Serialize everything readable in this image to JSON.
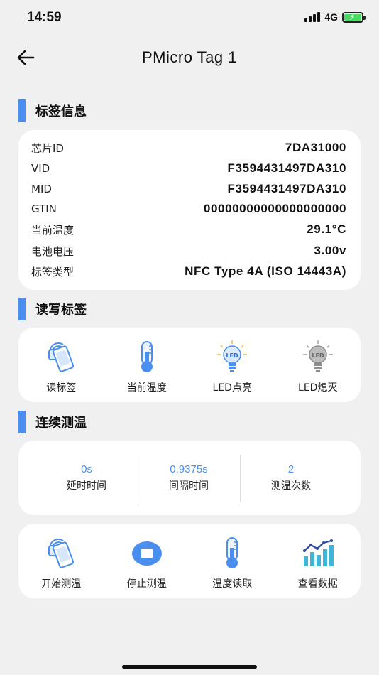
{
  "status": {
    "time": "14:59",
    "network": "4G"
  },
  "nav": {
    "title": "PMicro Tag 1"
  },
  "sections": {
    "tag_info": "标签信息",
    "read_write": "读写标签",
    "continuous": "连续测温"
  },
  "tag_info": [
    {
      "label": "芯片ID",
      "value": "7DA31000"
    },
    {
      "label": "VID",
      "value": "F3594431497DA310"
    },
    {
      "label": "MID",
      "value": "F3594431497DA310"
    },
    {
      "label": "GTIN",
      "value": "00000000000000000000"
    },
    {
      "label": "当前温度",
      "value": "29.1°C"
    },
    {
      "label": "电池电压",
      "value": "3.00v"
    },
    {
      "label": "标签类型",
      "value": "NFC Type 4A (ISO 14443A)"
    }
  ],
  "rw_buttons": [
    {
      "label": "读标签",
      "icon": "nfc-phone-icon"
    },
    {
      "label": "当前温度",
      "icon": "thermometer-icon"
    },
    {
      "label": "LED点亮",
      "icon": "led-on-icon"
    },
    {
      "label": "LED熄灭",
      "icon": "led-off-icon"
    }
  ],
  "measure": [
    {
      "value": "0s",
      "label": "延时时间"
    },
    {
      "value": "0.9375s",
      "label": "间隔时间"
    },
    {
      "value": "2",
      "label": "测温次数"
    }
  ],
  "action_buttons": [
    {
      "label": "开始测温",
      "icon": "nfc-phone-icon"
    },
    {
      "label": "停止测温",
      "icon": "stop-icon"
    },
    {
      "label": "温度读取",
      "icon": "thermometer-icon"
    },
    {
      "label": "查看数据",
      "icon": "bar-chart-icon"
    }
  ],
  "colors": {
    "accent": "#4a8ff0",
    "background": "#f0f0f0",
    "card": "#ffffff",
    "battery": "#4cd964"
  }
}
